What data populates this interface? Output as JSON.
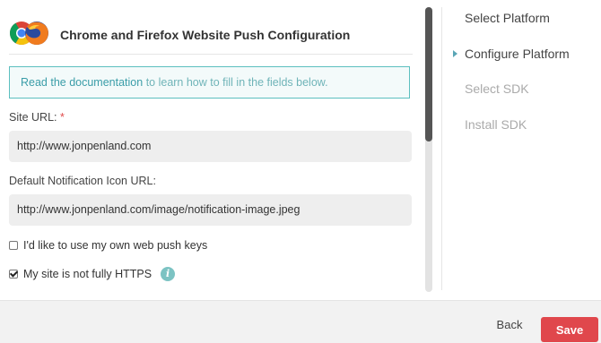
{
  "header": {
    "title": "Chrome and Firefox Website Push Configuration",
    "logo_icon": "chrome-firefox-logo-icon"
  },
  "info_box": {
    "link_text": "Read the documentation",
    "rest_text": " to learn how to fill in the fields below."
  },
  "form": {
    "site_url": {
      "label": "Site URL:",
      "required_mark": "*",
      "value": "http://www.jonpenland.com"
    },
    "icon_url": {
      "label": "Default Notification Icon URL:",
      "value": "http://www.jonpenland.com/image/notification-image.jpeg"
    },
    "own_keys": {
      "label": "I'd like to use my own web push keys",
      "checked": false
    },
    "not_https": {
      "label": "My site is not fully HTTPS",
      "checked": true,
      "info_icon": "i"
    }
  },
  "steps": [
    {
      "label": "Select Platform",
      "state": "done"
    },
    {
      "label": "Configure Platform",
      "state": "active"
    },
    {
      "label": "Select SDK",
      "state": "pending"
    },
    {
      "label": "Install SDK",
      "state": "pending"
    }
  ],
  "footer": {
    "back_label": "Back",
    "save_label": "Save"
  },
  "colors": {
    "accent": "#5cbfbf",
    "save": "#e0474c",
    "link": "#3a9da8"
  }
}
